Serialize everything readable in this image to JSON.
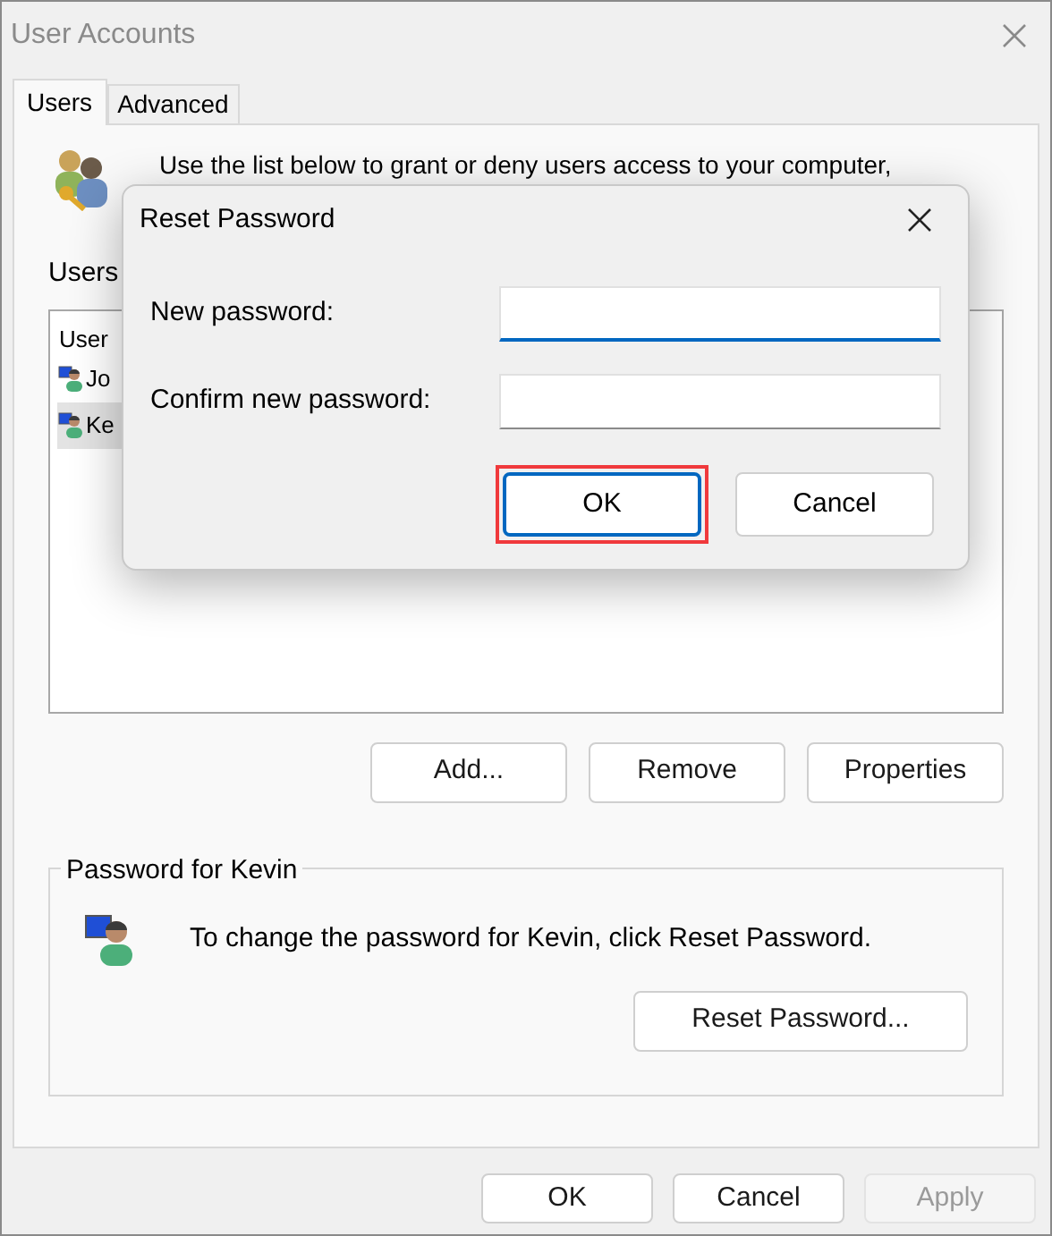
{
  "window": {
    "title": "User Accounts"
  },
  "tabs": [
    {
      "label": "Users",
      "selected": true
    },
    {
      "label": "Advanced",
      "selected": false
    }
  ],
  "intro": "Use the list below to grant or deny users access to your computer,",
  "users_label": "Users",
  "user_list": {
    "header": "User",
    "rows": [
      {
        "name": "Jo",
        "selected": false
      },
      {
        "name": "Ke",
        "selected": true
      }
    ]
  },
  "list_buttons": [
    "Add...",
    "Remove",
    "Properties"
  ],
  "password_group": {
    "title": "Password for Kevin",
    "text": "To change the password for Kevin, click Reset Password.",
    "button": "Reset Password..."
  },
  "footer_buttons": [
    {
      "label": "OK",
      "disabled": false
    },
    {
      "label": "Cancel",
      "disabled": false
    },
    {
      "label": "Apply",
      "disabled": true
    }
  ],
  "dialog": {
    "title": "Reset Password",
    "fields": [
      {
        "label": "New password:",
        "focused": true
      },
      {
        "label": "Confirm new password:",
        "focused": false
      }
    ],
    "buttons": [
      {
        "label": "OK",
        "highlighted": true
      },
      {
        "label": "Cancel",
        "highlighted": false
      }
    ]
  }
}
